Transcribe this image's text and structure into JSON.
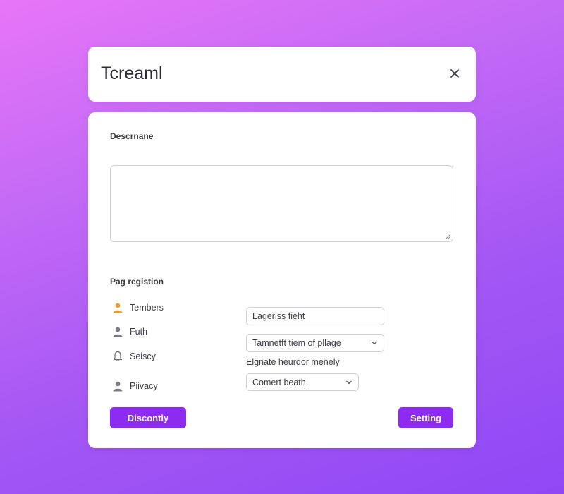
{
  "header": {
    "title": "Tcreaml",
    "close_icon": "close-icon"
  },
  "form": {
    "description_label": "Descrnane",
    "description_value": "",
    "registration_label": "Pag registion"
  },
  "nav_items": [
    {
      "label": "Tembers",
      "icon": "person-icon",
      "color": "#f09a32"
    },
    {
      "label": "Futh",
      "icon": "person-icon",
      "color": "#7a7a84"
    },
    {
      "label": "Seiscy",
      "icon": "bell-icon",
      "color": "#7a7a84"
    },
    {
      "label": "Piivacy",
      "icon": "person-icon",
      "color": "#7a7a84"
    }
  ],
  "inputs": {
    "text_value": "Lageriss fieht",
    "select_1_value": "Tamnetft tiem of pllage",
    "helper_text": "Elgnate heurdor menely",
    "select_2_value": "Comert beath"
  },
  "buttons": {
    "left_label": "Discontly",
    "right_label": "Setting"
  },
  "colors": {
    "accent": "#8d2cf0",
    "background_top": "#e876f7",
    "background_bottom": "#8f48f5",
    "highlight_icon": "#f09a32"
  }
}
